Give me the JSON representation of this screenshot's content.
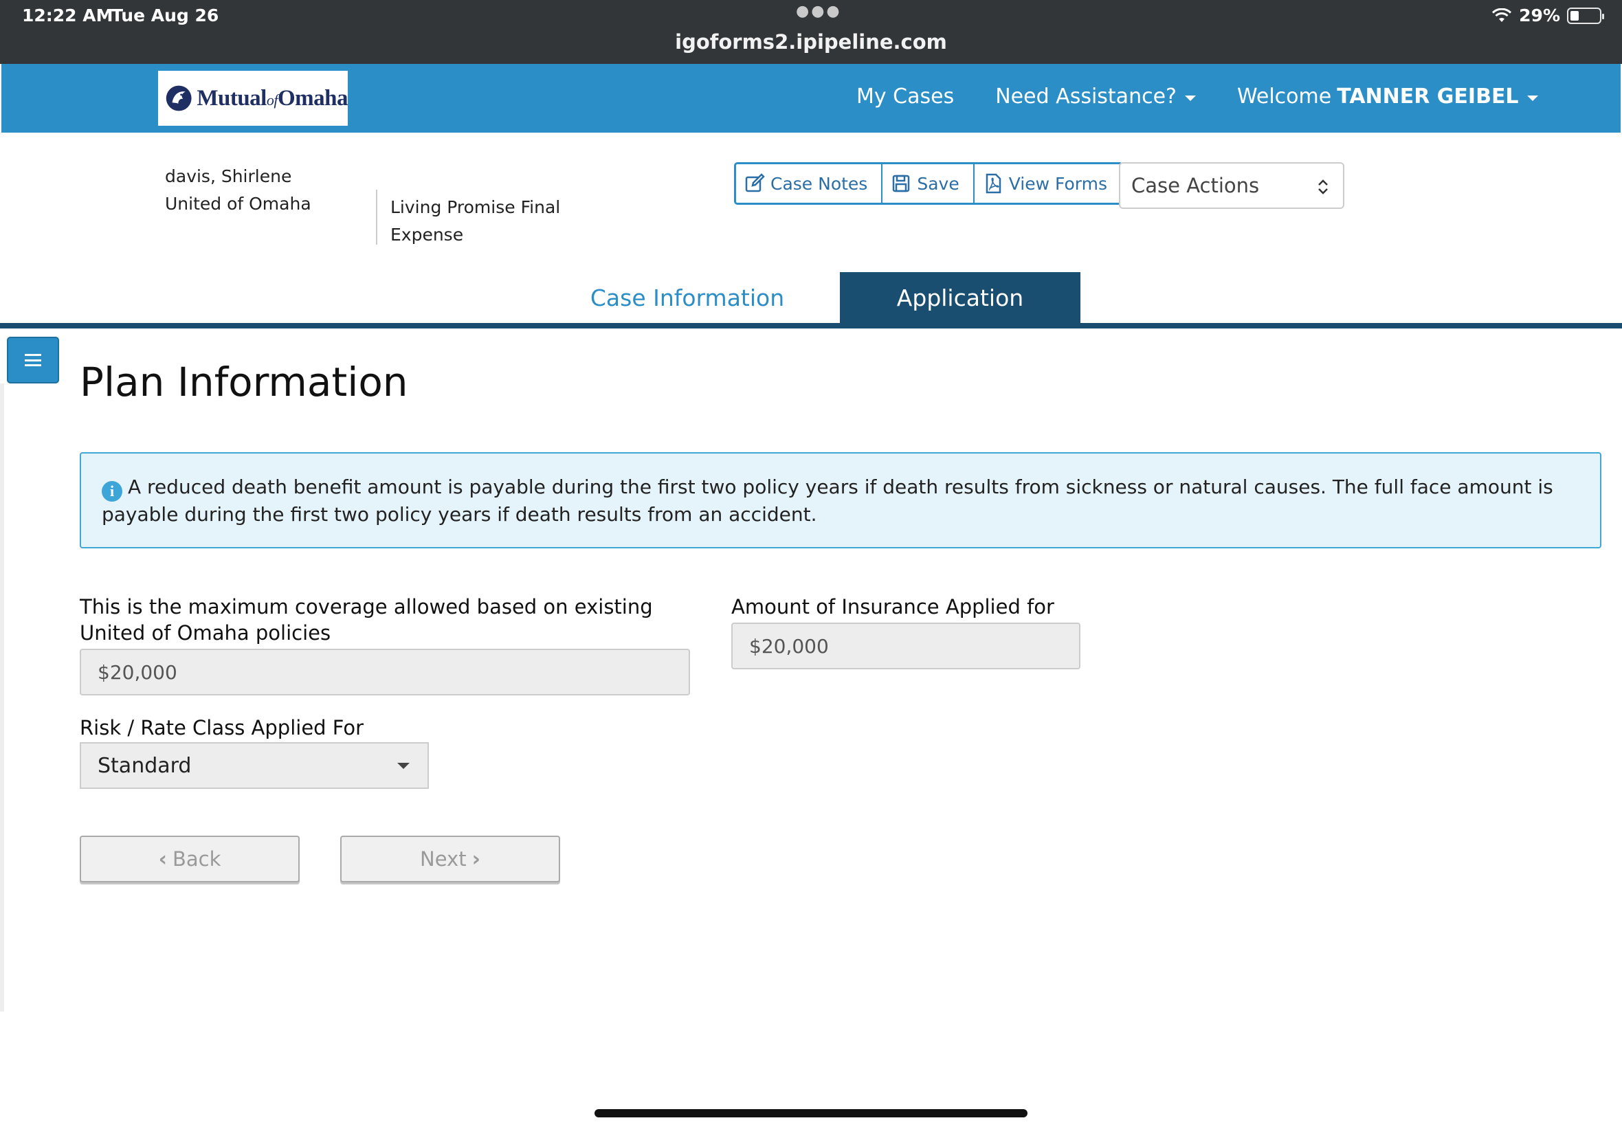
{
  "status_bar": {
    "time": "12:22 AM",
    "date": "Tue Aug 26",
    "url": "igoforms2.ipipeline.com",
    "battery": "29%"
  },
  "navbar": {
    "logo": {
      "prefix": "Mutual",
      "of": "of",
      "suffix": "Omaha"
    },
    "my_cases": "My Cases",
    "need_assistance": "Need Assistance?",
    "welcome": "Welcome",
    "user_name": "TANNER GEIBEL"
  },
  "case_header": {
    "client_name": "davis, Shirlene",
    "company": "United of Omaha",
    "product": "Living Promise Final Expense"
  },
  "toolbar": {
    "case_notes": "Case Notes",
    "save": "Save",
    "view_forms": "View Forms",
    "case_actions": "Case Actions"
  },
  "tabs": {
    "case_information": "Case Information",
    "application": "Application"
  },
  "page": {
    "title": "Plan Information",
    "alert": "A reduced death benefit amount is payable during the first two policy years if death results from sickness or natural causes. The full face amount is payable during the first two policy years if death results from an accident."
  },
  "form": {
    "max_coverage_label": "This is the maximum coverage allowed based on existing United of Omaha policies",
    "max_coverage_value": "$20,000",
    "amount_label": "Amount of Insurance Applied for",
    "amount_value": "$20,000",
    "risk_label": "Risk / Rate Class Applied For",
    "risk_value": "Standard"
  },
  "buttons": {
    "back": "Back",
    "next": "Next"
  },
  "colors": {
    "navbar": "#2b8ec6",
    "active_tab": "#1a4e70",
    "alert_bg": "#e4f4fa"
  }
}
